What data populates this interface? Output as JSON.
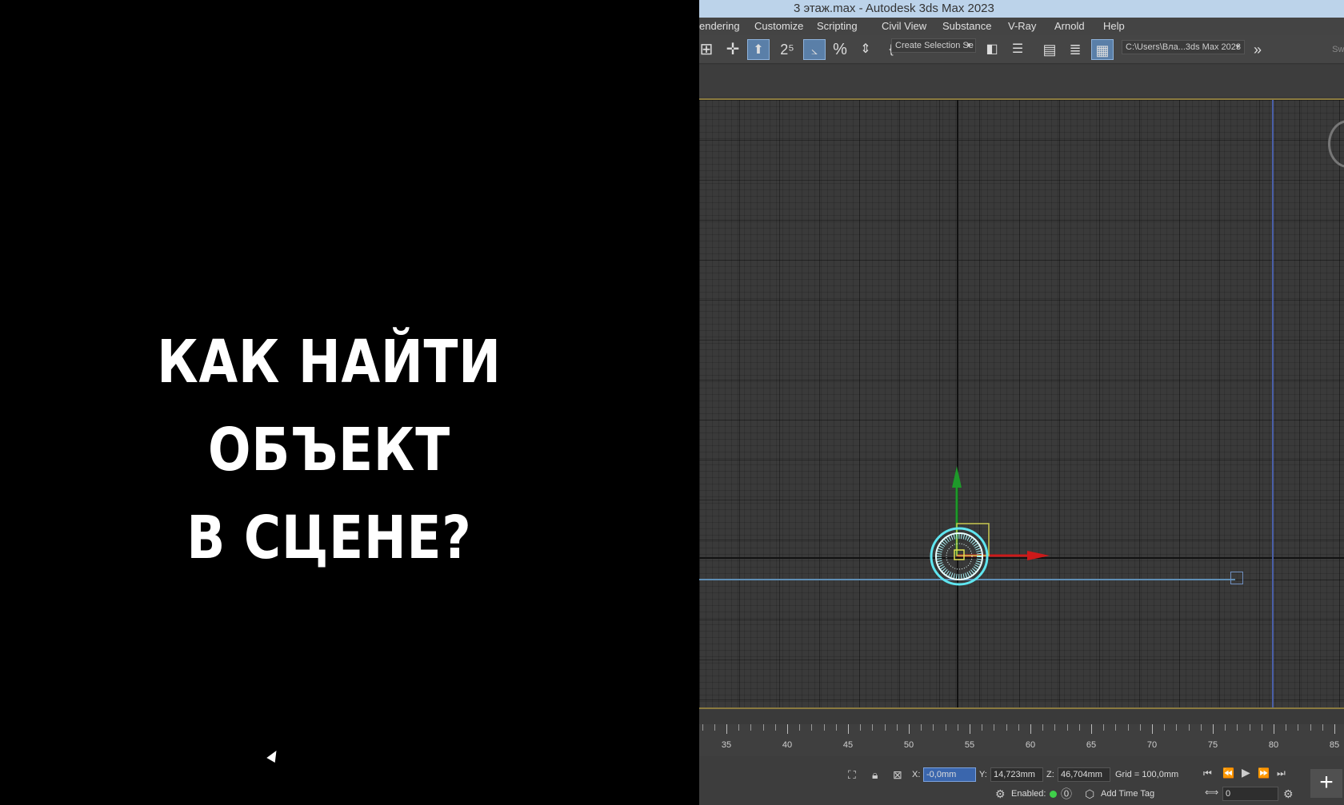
{
  "promo": {
    "line1": "КАК НАЙТИ ОБЪЕКТ",
    "line2": "В СЦЕНЕ?"
  },
  "window": {
    "title": "3 этаж.max - Autodesk 3ds Max 2023"
  },
  "menu": {
    "items": [
      {
        "label": "endering"
      },
      {
        "label": "Customize"
      },
      {
        "label": "Scripting"
      },
      {
        "label": "Civil View"
      },
      {
        "label": "Substance"
      },
      {
        "label": "V-Ray"
      },
      {
        "label": "Arnold"
      },
      {
        "label": "Help"
      }
    ]
  },
  "toolbar": {
    "selection_set": "Create Selection Se",
    "project_path": "C:\\Users\\Вла...3ds Max 2023",
    "overflow": "»",
    "right_cut": "Swi"
  },
  "timeline": {
    "labels": [
      "35",
      "40",
      "45",
      "50",
      "55",
      "60",
      "65",
      "70",
      "75",
      "80",
      "85"
    ]
  },
  "status": {
    "x_label": "X:",
    "x_value": "-0,0mm",
    "y_label": "Y:",
    "y_value": "14,723mm",
    "z_label": "Z:",
    "z_value": "46,704mm",
    "grid": "Grid = 100,0mm",
    "enabled_label": "Enabled:",
    "add_time_tag": "Add Time Tag",
    "frame_value": "0"
  },
  "colors": {
    "title_bar": "#bcd3ea",
    "selection_blue": "#3a66ad",
    "axis_x": "#cc1a1a",
    "axis_y": "#1e9a2a",
    "object": "#5fe6f0"
  }
}
